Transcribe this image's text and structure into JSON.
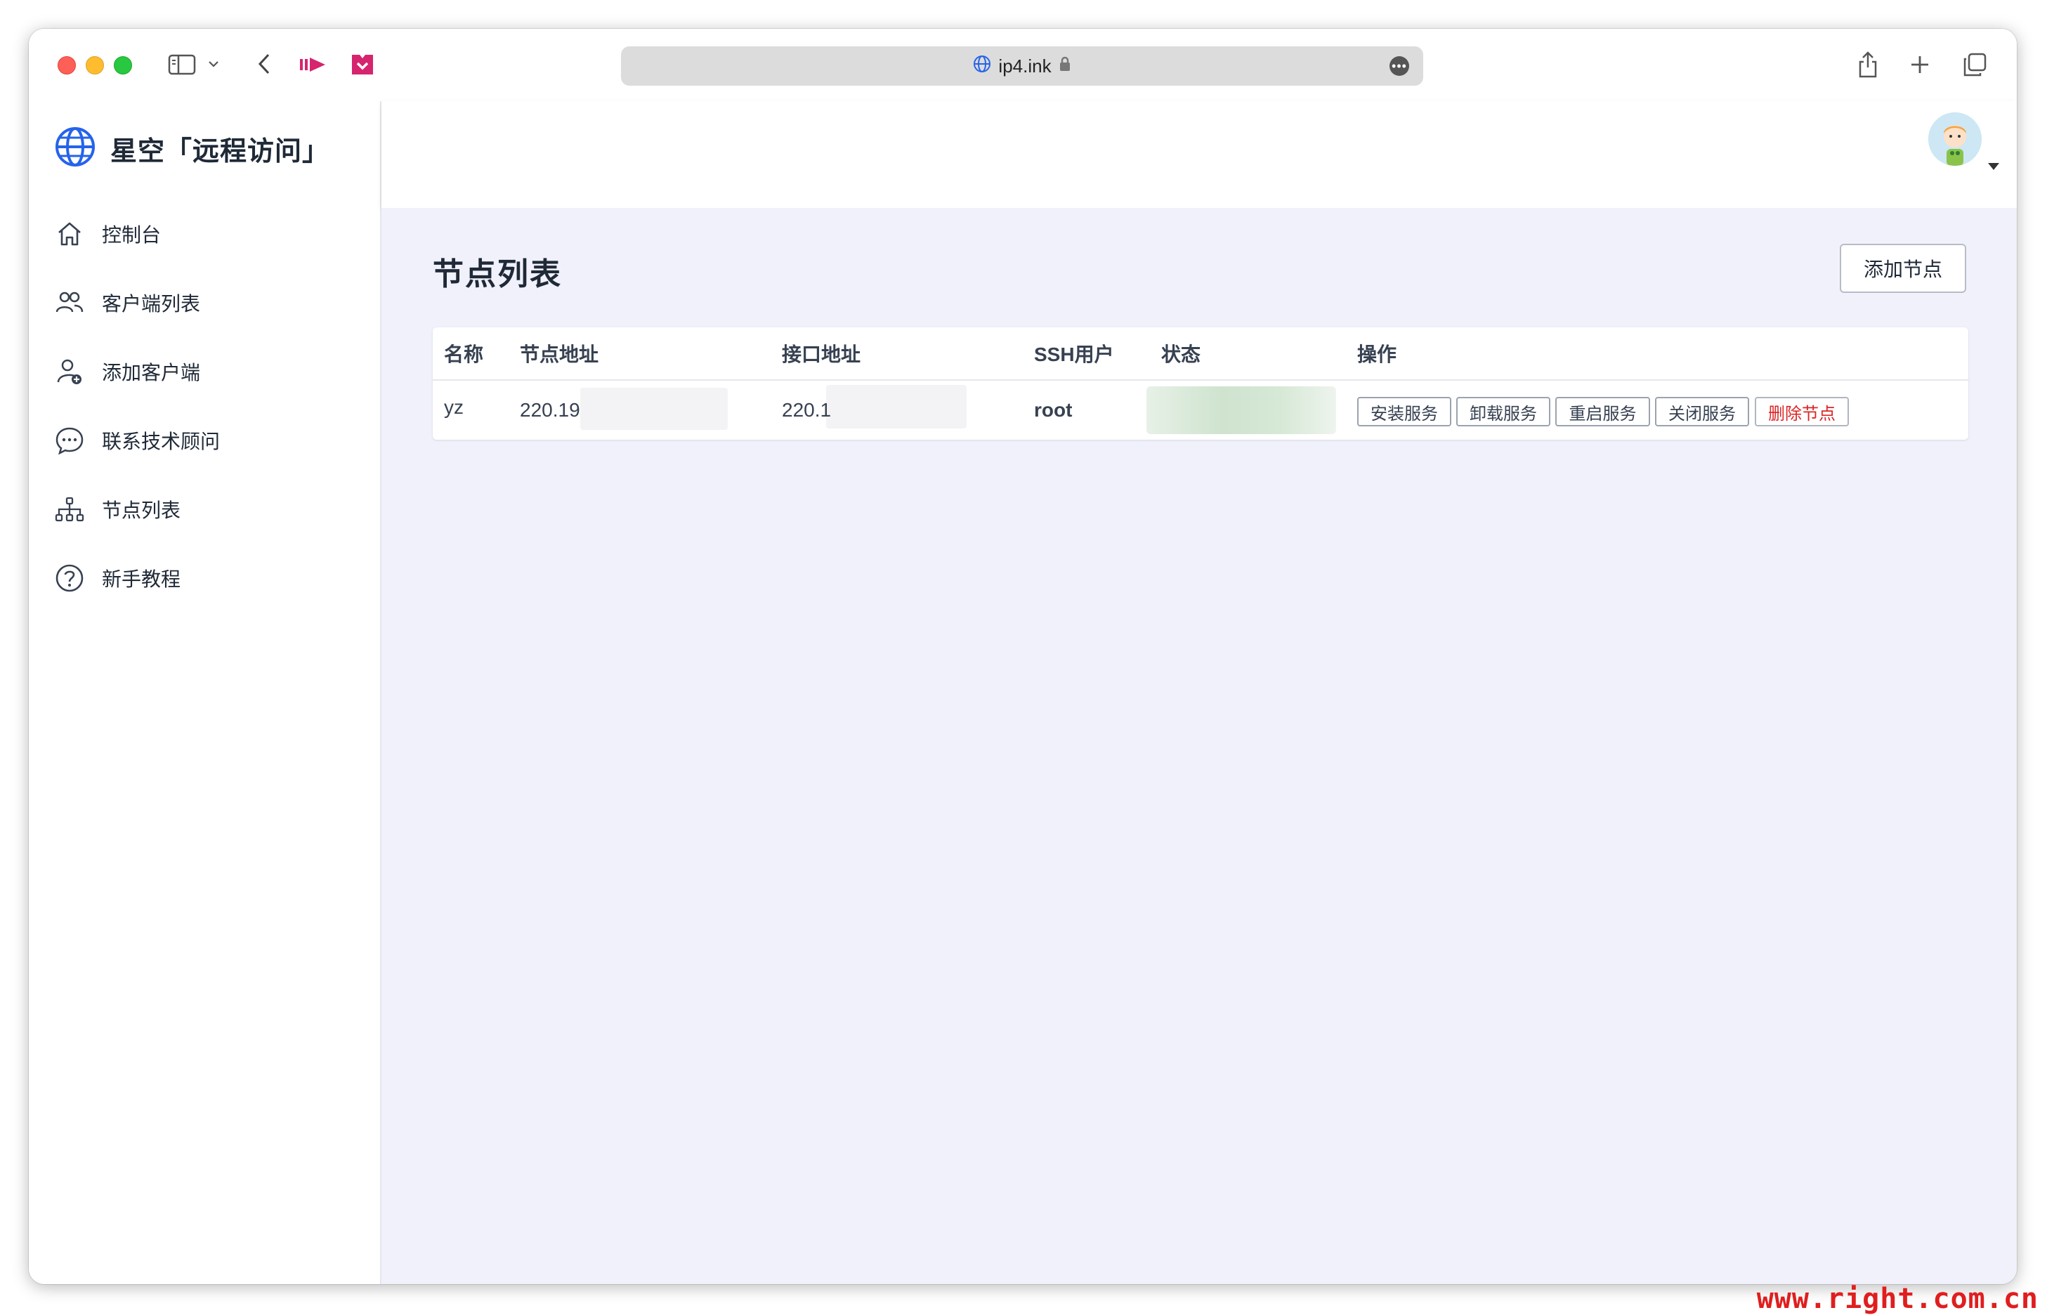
{
  "browser": {
    "url": "ip4.ink"
  },
  "brand": {
    "title": "星空「远程访问」"
  },
  "sidebar": {
    "items": [
      {
        "label": "控制台",
        "icon": "home-icon"
      },
      {
        "label": "客户端列表",
        "icon": "users-icon"
      },
      {
        "label": "添加客户端",
        "icon": "user-add-icon"
      },
      {
        "label": "联系技术顾问",
        "icon": "chat-icon"
      },
      {
        "label": "节点列表",
        "icon": "network-icon"
      },
      {
        "label": "新手教程",
        "icon": "help-icon"
      }
    ]
  },
  "page": {
    "title": "节点列表",
    "add_button": "添加节点"
  },
  "table": {
    "headers": [
      "名称",
      "节点地址",
      "接口地址",
      "SSH用户",
      "状态",
      "操作"
    ],
    "rows": [
      {
        "name": "yz",
        "node_address": "220.19",
        "api_address": "220.1",
        "ssh_user": "root",
        "actions": [
          "安装服务",
          "卸载服务",
          "重启服务",
          "关闭服务",
          "删除节点"
        ]
      }
    ]
  },
  "watermark": "www.right.com.cn",
  "colors": {
    "accent": "#2563eb",
    "danger": "#dc2626",
    "main_bg": "#f0f1fb"
  }
}
